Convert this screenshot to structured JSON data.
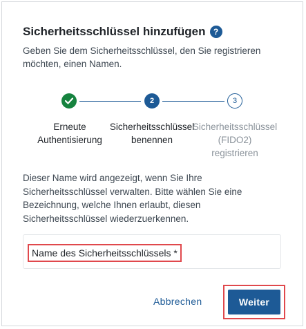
{
  "dialog": {
    "title": "Sicherheitsschlüssel hinzufügen",
    "help_icon": "?",
    "subtitle": "Geben Sie dem Sicherheitsschlüssel, den Sie registrieren möchten, einen Namen."
  },
  "steps": [
    {
      "icon": "check-icon",
      "number": "",
      "line1": "Erneute",
      "line2": "Authentisierung",
      "line3": "",
      "state": "done"
    },
    {
      "icon": "",
      "number": "2",
      "line1": "Sicherheitsschlüssel",
      "line2": "benennen",
      "line3": "",
      "state": "active"
    },
    {
      "icon": "",
      "number": "3",
      "line1": "Sicherheitsschlüssel",
      "line2": "(FIDO2)",
      "line3": "registrieren",
      "state": "pending"
    }
  ],
  "info_text": "Dieser Name wird angezeigt, wenn Sie Ihre Sicherheitsschlüssel verwalten. Bitte wählen Sie eine Bezeichnung, welche Ihnen erlaubt, diesen Sicherheitsschlüssel wiederzuerkennen.",
  "form": {
    "name_label": "Name des Sicherheitsschlüssels *",
    "name_value": ""
  },
  "actions": {
    "cancel_label": "Abbrechen",
    "submit_label": "Weiter"
  },
  "colors": {
    "primary": "#1d5a96",
    "success": "#16833f",
    "highlight": "#e0484c"
  }
}
